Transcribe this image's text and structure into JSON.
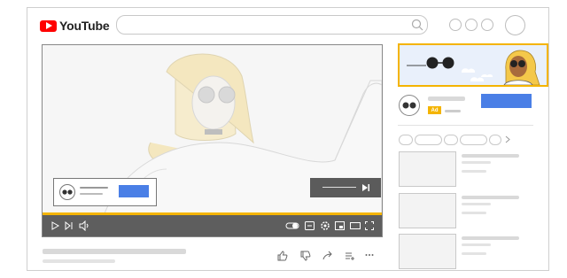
{
  "header": {
    "brand": "YouTube",
    "icons": [
      "search-icon",
      "circle-icon",
      "circle-icon",
      "circle-icon",
      "avatar"
    ]
  },
  "ad": {
    "badge": "Ad"
  },
  "player": {
    "controls_left": [
      "play-icon",
      "next-icon",
      "volume-icon"
    ],
    "controls_right": [
      "autoplay-toggle-icon",
      "captions-icon",
      "settings-icon",
      "miniplayer-icon",
      "theater-icon",
      "fullscreen-icon"
    ]
  },
  "actions": [
    "like-icon",
    "dislike-icon",
    "share-icon",
    "save-icon",
    "more-icon"
  ],
  "colors": {
    "brand_red": "#ff0000",
    "accent_yellow": "#f4b400",
    "ad_blue": "#4a7fe6",
    "controls_gray": "#5e5e5e"
  }
}
